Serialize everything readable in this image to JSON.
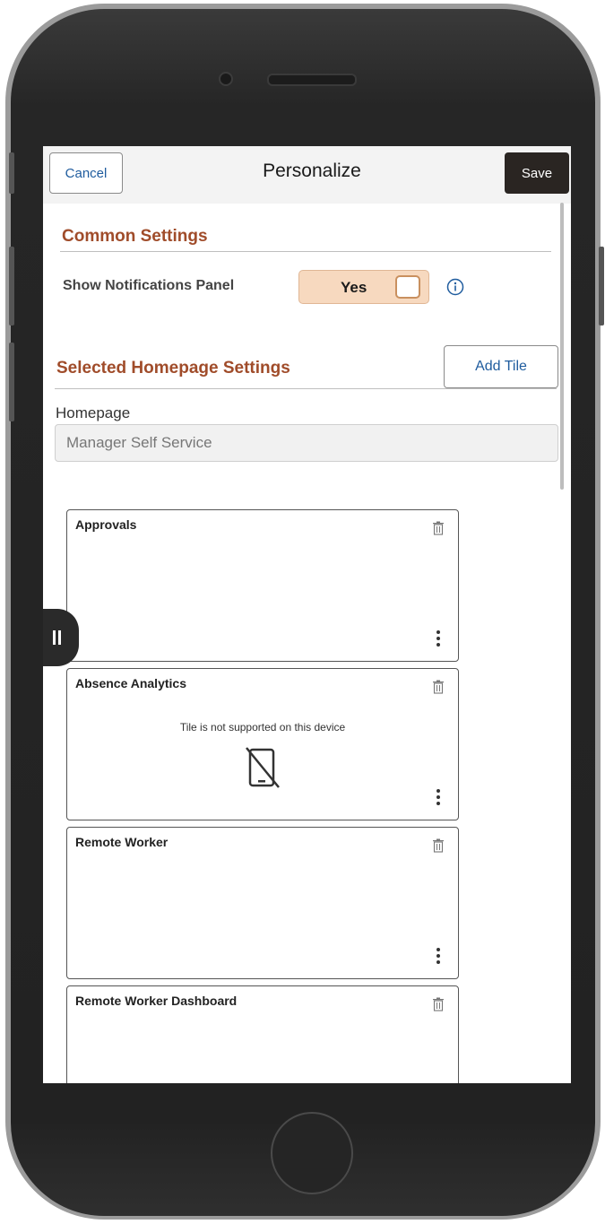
{
  "header": {
    "cancel_label": "Cancel",
    "title": "Personalize",
    "save_label": "Save"
  },
  "common_settings": {
    "title": "Common Settings",
    "notifications_label": "Show Notifications Panel",
    "notifications_value": "Yes",
    "info_icon": "info-icon"
  },
  "homepage_settings": {
    "title": "Selected Homepage Settings",
    "add_tile_label": "Add Tile",
    "homepage_label": "Homepage",
    "homepage_value": "Manager Self Service"
  },
  "tiles": [
    {
      "title": "Approvals",
      "message": ""
    },
    {
      "title": "Absence Analytics",
      "message": "Tile is not supported on this device"
    },
    {
      "title": "Remote Worker",
      "message": ""
    },
    {
      "title": "Remote Worker Dashboard",
      "message": ""
    }
  ],
  "colors": {
    "section_title": "#a04c2a",
    "link_blue": "#1f5c9e",
    "toggle_bg": "#f7d9bf",
    "save_bg": "#2a2522"
  }
}
